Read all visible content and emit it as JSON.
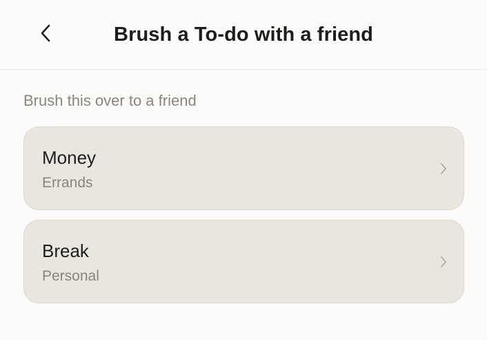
{
  "header": {
    "title": "Brush a To-do with a friend",
    "back_icon": "chevron-left-icon"
  },
  "section": {
    "label": "Brush this over to a friend"
  },
  "items": [
    {
      "title": "Money",
      "subtitle": "Errands",
      "icon": "chevron-right-icon"
    },
    {
      "title": "Break",
      "subtitle": "Personal",
      "icon": "chevron-right-icon"
    }
  ],
  "colors": {
    "background": "#fcfbf9",
    "card": "#e9e6e0",
    "text_primary": "#1f1d1a",
    "text_secondary": "#8a857c"
  }
}
